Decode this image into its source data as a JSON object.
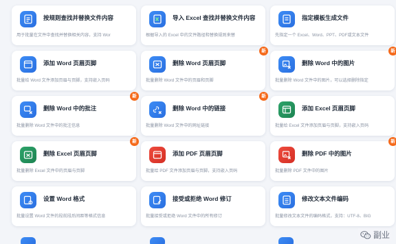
{
  "badge_text": "新",
  "cards": [
    {
      "title": "按规则查找并替换文件内容",
      "desc": "用于批量在文件中查找并替换相关内容，支持 Wor",
      "icon": "edit-doc-icon",
      "color": "blue",
      "badge": false
    },
    {
      "title": "导入 Excel 查找并替换文件内容",
      "desc": "根据导入的 Excel 中的文件路径和替换规则来替",
      "icon": "excel-replace-icon",
      "color": "blue",
      "badge": false
    },
    {
      "title": "指定模板生成文件",
      "desc": "先指定一个 Excel、Word、PPT、PDF或文本文件",
      "icon": "template-doc-icon",
      "color": "blue",
      "badge": false
    },
    {
      "title": "添加 Word 页眉页脚",
      "desc": "批量给 Word 文件添加页眉与页脚，支持嵌入页码",
      "icon": "header-footer-icon",
      "color": "blue",
      "badge": false
    },
    {
      "title": "删除 Word 页眉页脚",
      "desc": "批量删除 Word 文件中的页眉和页脚",
      "icon": "delete-header-icon",
      "color": "blue",
      "badge": true
    },
    {
      "title": "删除 Word 中的图片",
      "desc": "批量删除 Word 文件中的图片，可以选择删除指定",
      "icon": "delete-image-icon",
      "color": "blue",
      "badge": true
    },
    {
      "title": "删除 Word 中的批注",
      "desc": "批量删除 Word 文件中的批注信息",
      "icon": "delete-comment-icon",
      "color": "blue",
      "badge": true
    },
    {
      "title": "删除 Word 中的链接",
      "desc": "批量删除 Word 文件中的网址链接",
      "icon": "delete-link-icon",
      "color": "blue",
      "badge": true
    },
    {
      "title": "添加 Excel 页眉页脚",
      "desc": "批量给 Excel 文件添加页眉与页脚，支持嵌入页码",
      "icon": "excel-header-icon",
      "color": "green",
      "badge": false
    },
    {
      "title": "删除 Excel 页眉页脚",
      "desc": "批量删除 Excel 文件中的页眉与页脚",
      "icon": "excel-delete-header-icon",
      "color": "green",
      "badge": true
    },
    {
      "title": "添加 PDF 页眉页脚",
      "desc": "批量给 PDF 文件添加页眉与页脚，支持嵌入页码",
      "icon": "pdf-header-icon",
      "color": "red",
      "badge": false
    },
    {
      "title": "删除 PDF 中的图片",
      "desc": "批量删除 PDF 文件中的图片",
      "icon": "pdf-delete-image-icon",
      "color": "red",
      "badge": true
    },
    {
      "title": "设置 Word 格式",
      "desc": "批量设置 Word 文件的段前段后间距等格式信息",
      "icon": "format-settings-icon",
      "color": "blue",
      "badge": false
    },
    {
      "title": "接受或拒绝 Word 修订",
      "desc": "批量接受或拒绝 Word 文件中的所有修订",
      "icon": "revision-icon",
      "color": "blue",
      "badge": false
    },
    {
      "title": "修改文本文件编码",
      "desc": "批量修改文本文件的编码格式，支持：UTF-8、BIG",
      "icon": "text-encoding-icon",
      "color": "blue",
      "badge": false
    }
  ],
  "watermark": {
    "text": "副业",
    "icon": "wechat-icon"
  }
}
